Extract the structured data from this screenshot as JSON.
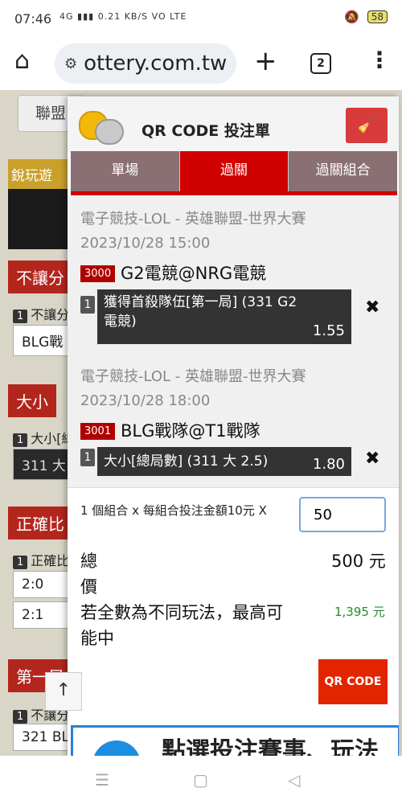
{
  "status": {
    "time": "07:46",
    "signal": "4G",
    "speed": "0.21 KB/S",
    "volte": "VO LTE",
    "battery": "58"
  },
  "browser": {
    "url": "ottery.com.tw",
    "tab_count": "2"
  },
  "background": {
    "button": "聯盟",
    "section1": "銳玩遊",
    "red1": "不讓分",
    "r1_label": "不讓分",
    "r1_value": "BLG戰",
    "red2": "大小",
    "r2_label": "大小[總",
    "r2_value": "311 大",
    "red3": "正確比",
    "r3_label": "正確比",
    "r3_v1": "2:0",
    "r3_v2": "2:1",
    "red4": "第一局",
    "r4_label": "不讓分",
    "r4_value": "321 BL"
  },
  "panel": {
    "title": "QR CODE 投注單",
    "tabs": [
      "單場",
      "過關",
      "過關組合"
    ],
    "bets": [
      {
        "league": "電子競技-LOL - 英雄聯盟-世界大賽",
        "datetime": "2023/10/28 15:00",
        "code": "3000",
        "match": "G2電競@NRG電競",
        "num": "1",
        "selection": "獲得首殺隊伍[第一局] (331 G2電競)",
        "odds": "1.55"
      },
      {
        "league": "電子競技-LOL - 英雄聯盟-世界大賽",
        "datetime": "2023/10/28 18:00",
        "code": "3001",
        "match": "BLG戰隊@T1戰隊",
        "num": "1",
        "selection": "大小[總局數] (311 大 2.5)",
        "odds": "1.80"
      }
    ],
    "combo_text": "1 個組合 x 每組合投注金額10元 X",
    "amount_value": "50",
    "total_label_1": "總",
    "total_label_2": "價",
    "total_value": "500 元",
    "max_label": "若全數為不同玩法，最高可能中",
    "max_value": "1,395 元",
    "qr_button": "QR CODE",
    "promo_text": "點選投注賽事、玩法"
  }
}
